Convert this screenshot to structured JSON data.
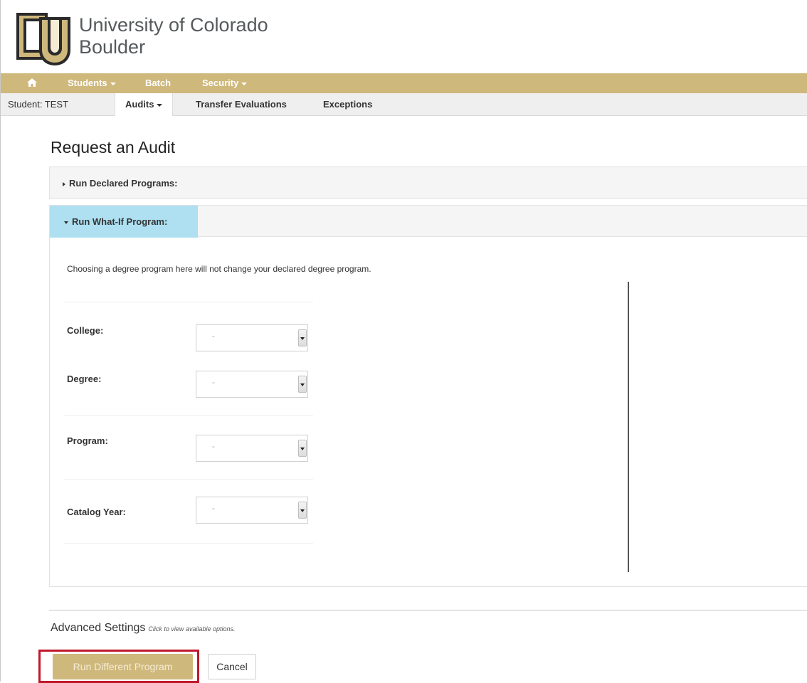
{
  "header": {
    "university_line1": "University of Colorado",
    "university_line2": "Boulder",
    "logo_icon": "cu-logo-icon"
  },
  "topnav": {
    "home_icon": "home-icon",
    "items": [
      {
        "label": "Students",
        "dropdown": true
      },
      {
        "label": "Batch",
        "dropdown": false
      },
      {
        "label": "Security",
        "dropdown": true
      }
    ]
  },
  "subnav": {
    "student": "Student: TEST",
    "tabs": [
      {
        "label": "Audits",
        "dropdown": true,
        "active": true
      },
      {
        "label": "Transfer Evaluations",
        "dropdown": false,
        "active": false
      },
      {
        "label": "Exceptions",
        "dropdown": false,
        "active": false
      }
    ]
  },
  "page": {
    "title": "Request an Audit",
    "declared_panel": "Run Declared Programs:",
    "whatif_panel": "Run What-If Program:",
    "notice": "Choosing a degree program here will not change your declared degree program."
  },
  "fields": [
    {
      "label": "College:",
      "value": "-"
    },
    {
      "label": "Degree:",
      "value": "-"
    },
    {
      "label": "Program:",
      "value": "-"
    },
    {
      "label": "Catalog Year:",
      "value": "-"
    }
  ],
  "advanced": {
    "title": "Advanced Settings",
    "hint": "Click to view available options."
  },
  "buttons": {
    "run": "Run Different Program",
    "cancel": "Cancel"
  },
  "colors": {
    "brand_gold": "#cfb87c",
    "active_panel": "#aee0f2",
    "highlight": "#c0182b"
  }
}
